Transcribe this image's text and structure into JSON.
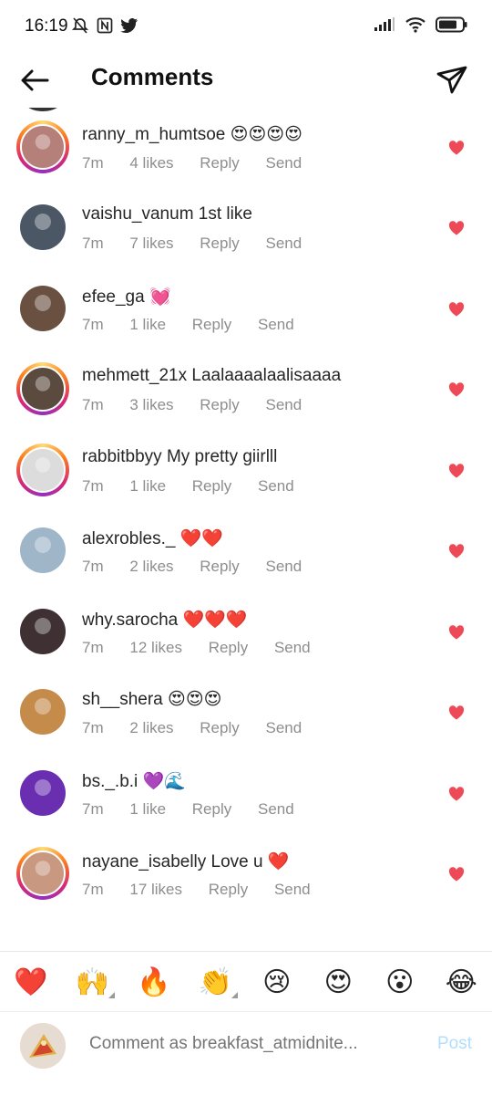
{
  "status_bar": {
    "time": "16:19"
  },
  "header": {
    "title": "Comments"
  },
  "comments": [
    {
      "user": "ranny_m_humtsoe",
      "text": " 😍😍😍😍",
      "time": "7m",
      "likes": "4 likes",
      "reply": "Reply",
      "send": "Send",
      "story_ring": true,
      "avatar_color": "#b6807a"
    },
    {
      "user": "vaishu_vanum",
      "text": " 1st like",
      "time": "7m",
      "likes": "7 likes",
      "reply": "Reply",
      "send": "Send",
      "story_ring": false,
      "avatar_color": "#4c5766"
    },
    {
      "user": "efee_ga",
      "text": " 💓",
      "time": "7m",
      "likes": "1 like",
      "reply": "Reply",
      "send": "Send",
      "story_ring": false,
      "avatar_color": "#6a5040"
    },
    {
      "user": "mehmett_21x",
      "text": " Laalaaaalaalisaaaa",
      "time": "7m",
      "likes": "3 likes",
      "reply": "Reply",
      "send": "Send",
      "story_ring": true,
      "avatar_color": "#5b4a3e"
    },
    {
      "user": "rabbitbbyy",
      "text": " My pretty giirlll",
      "time": "7m",
      "likes": "1 like",
      "reply": "Reply",
      "send": "Send",
      "story_ring": true,
      "avatar_color": "#dcdcdc"
    },
    {
      "user": "alexrobles._",
      "text": " ❤️❤️",
      "time": "7m",
      "likes": "2 likes",
      "reply": "Reply",
      "send": "Send",
      "story_ring": false,
      "avatar_color": "#9fb6c8"
    },
    {
      "user": "why.sarocha",
      "text": " ❤️❤️❤️",
      "time": "7m",
      "likes": "12 likes",
      "reply": "Reply",
      "send": "Send",
      "story_ring": false,
      "avatar_color": "#3e3033"
    },
    {
      "user": "sh__shera",
      "text": " 😍😍😍",
      "time": "7m",
      "likes": "2 likes",
      "reply": "Reply",
      "send": "Send",
      "story_ring": false,
      "avatar_color": "#c48b4a"
    },
    {
      "user": "bs._.b.i",
      "text": " 💜🌊",
      "time": "7m",
      "likes": "1 like",
      "reply": "Reply",
      "send": "Send",
      "story_ring": false,
      "avatar_color": "#6a2fb0"
    },
    {
      "user": "nayane_isabelly",
      "text": " Love u ❤️",
      "time": "7m",
      "likes": "17 likes",
      "reply": "Reply",
      "send": "Send",
      "story_ring": true,
      "avatar_color": "#c89880"
    }
  ],
  "emoji_bar": [
    "❤️",
    "🙌",
    "🔥",
    "👏",
    "😢",
    "😍",
    "😮",
    "😂"
  ],
  "composer": {
    "placeholder": "Comment as breakfast_atmidnite...",
    "post_label": "Post"
  },
  "colors": {
    "heart": "#ed4956",
    "meta": "#8e8e8e",
    "post": "#b2dffc"
  }
}
